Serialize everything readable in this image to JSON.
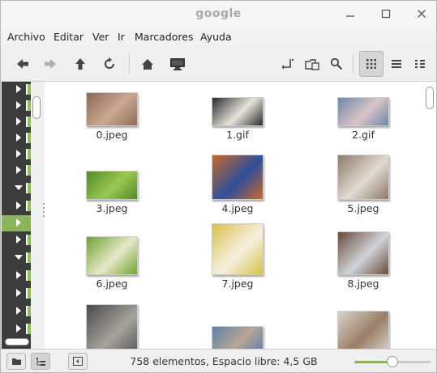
{
  "window": {
    "title": "google"
  },
  "menubar": {
    "items": [
      "Archivo",
      "Editar",
      "Ver",
      "Ir",
      "Marcadores",
      "Ayuda"
    ]
  },
  "toolbar": {
    "icons": [
      "back-icon",
      "forward-icon",
      "up-icon",
      "reload-icon",
      "home-icon",
      "computer-icon",
      "open-terminal-icon",
      "folder-new-icon",
      "search-icon",
      "icon-view-icon",
      "list-view-icon",
      "compact-view-icon"
    ]
  },
  "files": [
    {
      "name": "0.jpeg",
      "colors": [
        "#8e6a55",
        "#c9a892"
      ]
    },
    {
      "name": "1.gif",
      "colors": [
        "#2a2a2a",
        "#e8e4dc"
      ]
    },
    {
      "name": "2.gif",
      "colors": [
        "#6d87a8",
        "#d9c4c8"
      ]
    },
    {
      "name": "3.jpeg",
      "colors": [
        "#4f8a2a",
        "#9cc653"
      ]
    },
    {
      "name": "4.jpeg",
      "colors": [
        "#c8692a",
        "#2d4f9b"
      ]
    },
    {
      "name": "5.jpeg",
      "colors": [
        "#8a7a6a",
        "#e3dbd0"
      ]
    },
    {
      "name": "6.jpeg",
      "colors": [
        "#6fa32e",
        "#e6e8c8"
      ]
    },
    {
      "name": "7.jpeg",
      "colors": [
        "#d7c04a",
        "#f6f0e0"
      ]
    },
    {
      "name": "8.jpeg",
      "colors": [
        "#6a4a3a",
        "#cfd3d8"
      ]
    },
    {
      "name": "",
      "colors": [
        "#4a4a4a",
        "#a7a39c"
      ]
    },
    {
      "name": "",
      "colors": [
        "#5d7fa6",
        "#b8a796"
      ]
    },
    {
      "name": "",
      "colors": [
        "#d8d3cc",
        "#9a7f67"
      ]
    }
  ],
  "status": {
    "text": "758 elementos, Espacio libre: 4,5 GB",
    "zoom_fraction": 0.5
  },
  "statusbar_icons": [
    "places-icon",
    "tree-icon",
    "toggle-sidebar-icon"
  ],
  "accent_color": "#8ab55b"
}
